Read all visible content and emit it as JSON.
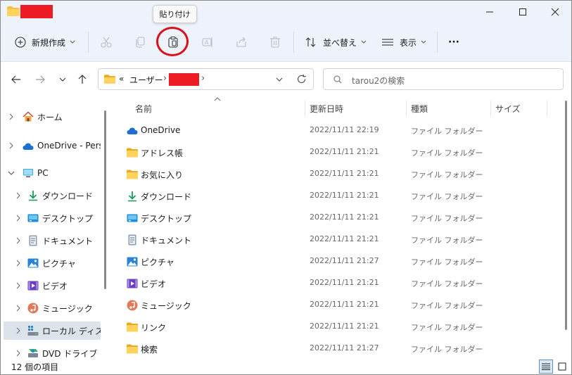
{
  "colors": {
    "accent": "#0067c0",
    "folder": "#f5c142",
    "redaction": "#ed1c24",
    "annotation": "#d7141c"
  },
  "titlebar": {
    "icon": "folder-icon",
    "title_redacted": true
  },
  "tooltip": {
    "text": "貼り付け"
  },
  "toolbar": {
    "new_label": "新規作成",
    "sort_label": "並べ替え",
    "view_label": "表示",
    "more_label": "···"
  },
  "address": {
    "prefix": "«",
    "crumb1": "ユーザー",
    "sep": "›"
  },
  "search": {
    "placeholder": "tarou2の検索"
  },
  "sidebar": {
    "items": [
      {
        "label": "ホーム",
        "icon": "home-icon"
      },
      {
        "label": "OneDrive - Perso",
        "icon": "cloud-icon"
      },
      {
        "label": "PC",
        "icon": "pc-icon"
      },
      {
        "label": "ダウンロード",
        "icon": "download-icon"
      },
      {
        "label": "デスクトップ",
        "icon": "desktop-icon"
      },
      {
        "label": "ドキュメント",
        "icon": "document-icon"
      },
      {
        "label": "ピクチャ",
        "icon": "picture-icon"
      },
      {
        "label": "ビデオ",
        "icon": "video-icon"
      },
      {
        "label": "ミュージック",
        "icon": "music-icon"
      },
      {
        "label": "ローカル ディスク (",
        "icon": "disk-icon"
      },
      {
        "label": "DVD ドライブ (D:)",
        "icon": "dvd-icon"
      }
    ]
  },
  "columns": {
    "name": "名前",
    "modified": "更新日時",
    "type": "種類",
    "size": "サイズ"
  },
  "files": [
    {
      "name": "OneDrive",
      "date": "2022/11/11 22:19",
      "type": "ファイル フォルダー",
      "icon": "cloud-icon"
    },
    {
      "name": "アドレス帳",
      "date": "2022/11/11 21:21",
      "type": "ファイル フォルダー",
      "icon": "folder-icon"
    },
    {
      "name": "お気に入り",
      "date": "2022/11/11 21:21",
      "type": "ファイル フォルダー",
      "icon": "folder-icon"
    },
    {
      "name": "ダウンロード",
      "date": "2022/11/11 21:21",
      "type": "ファイル フォルダー",
      "icon": "download-icon"
    },
    {
      "name": "デスクトップ",
      "date": "2022/11/11 21:21",
      "type": "ファイル フォルダー",
      "icon": "desktop-icon"
    },
    {
      "name": "ドキュメント",
      "date": "2022/11/11 21:21",
      "type": "ファイル フォルダー",
      "icon": "document-icon"
    },
    {
      "name": "ピクチャ",
      "date": "2022/11/11 21:27",
      "type": "ファイル フォルダー",
      "icon": "picture-icon"
    },
    {
      "name": "ビデオ",
      "date": "2022/11/11 21:21",
      "type": "ファイル フォルダー",
      "icon": "video-icon"
    },
    {
      "name": "ミュージック",
      "date": "2022/11/11 21:21",
      "type": "ファイル フォルダー",
      "icon": "music-icon"
    },
    {
      "name": "リンク",
      "date": "2022/11/11 21:21",
      "type": "ファイル フォルダー",
      "icon": "folder-icon"
    },
    {
      "name": "検索",
      "date": "2022/11/11 21:27",
      "type": "ファイル フォルダー",
      "icon": "folder-icon"
    }
  ],
  "status": {
    "count_text": "12 個の項目"
  }
}
